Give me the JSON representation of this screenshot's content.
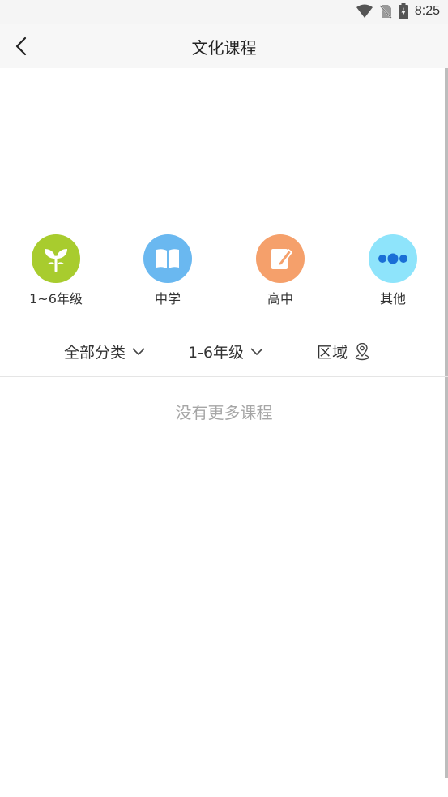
{
  "status_bar": {
    "time": "8:25"
  },
  "header": {
    "title": "文化课程"
  },
  "categories": [
    {
      "label": "1~6年级",
      "icon": "sprout-icon",
      "color": "#a8cc2e"
    },
    {
      "label": "中学",
      "icon": "open-book-icon",
      "color": "#6ab8f0"
    },
    {
      "label": "高中",
      "icon": "notebook-pen-icon",
      "color": "#f5a06b"
    },
    {
      "label": "其他",
      "icon": "more-dots-icon",
      "color": "#8ee4fb"
    }
  ],
  "filters": {
    "category": "全部分类",
    "grade": "1-6年级",
    "region": "区域"
  },
  "empty_message": "没有更多课程"
}
